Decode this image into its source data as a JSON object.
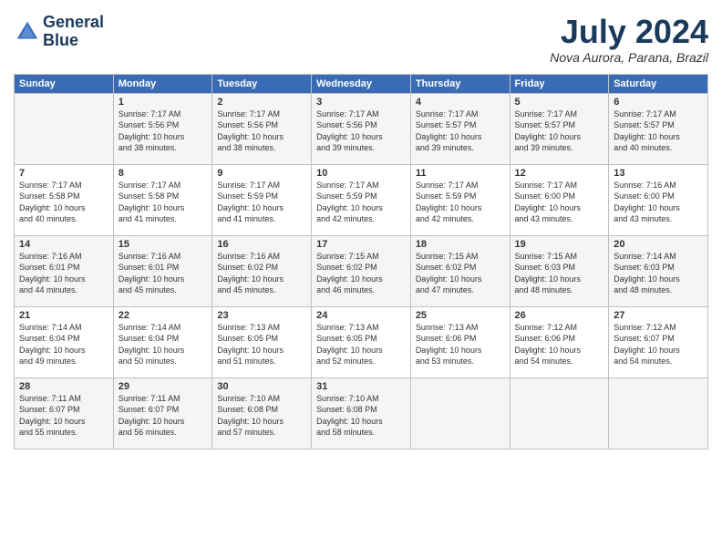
{
  "header": {
    "logo_line1": "General",
    "logo_line2": "Blue",
    "title": "July 2024",
    "location": "Nova Aurora, Parana, Brazil"
  },
  "days_of_week": [
    "Sunday",
    "Monday",
    "Tuesday",
    "Wednesday",
    "Thursday",
    "Friday",
    "Saturday"
  ],
  "weeks": [
    [
      {
        "day": "",
        "content": ""
      },
      {
        "day": "1",
        "content": "Sunrise: 7:17 AM\nSunset: 5:56 PM\nDaylight: 10 hours\nand 38 minutes."
      },
      {
        "day": "2",
        "content": "Sunrise: 7:17 AM\nSunset: 5:56 PM\nDaylight: 10 hours\nand 38 minutes."
      },
      {
        "day": "3",
        "content": "Sunrise: 7:17 AM\nSunset: 5:56 PM\nDaylight: 10 hours\nand 39 minutes."
      },
      {
        "day": "4",
        "content": "Sunrise: 7:17 AM\nSunset: 5:57 PM\nDaylight: 10 hours\nand 39 minutes."
      },
      {
        "day": "5",
        "content": "Sunrise: 7:17 AM\nSunset: 5:57 PM\nDaylight: 10 hours\nand 39 minutes."
      },
      {
        "day": "6",
        "content": "Sunrise: 7:17 AM\nSunset: 5:57 PM\nDaylight: 10 hours\nand 40 minutes."
      }
    ],
    [
      {
        "day": "7",
        "content": "Sunrise: 7:17 AM\nSunset: 5:58 PM\nDaylight: 10 hours\nand 40 minutes."
      },
      {
        "day": "8",
        "content": "Sunrise: 7:17 AM\nSunset: 5:58 PM\nDaylight: 10 hours\nand 41 minutes."
      },
      {
        "day": "9",
        "content": "Sunrise: 7:17 AM\nSunset: 5:59 PM\nDaylight: 10 hours\nand 41 minutes."
      },
      {
        "day": "10",
        "content": "Sunrise: 7:17 AM\nSunset: 5:59 PM\nDaylight: 10 hours\nand 42 minutes."
      },
      {
        "day": "11",
        "content": "Sunrise: 7:17 AM\nSunset: 5:59 PM\nDaylight: 10 hours\nand 42 minutes."
      },
      {
        "day": "12",
        "content": "Sunrise: 7:17 AM\nSunset: 6:00 PM\nDaylight: 10 hours\nand 43 minutes."
      },
      {
        "day": "13",
        "content": "Sunrise: 7:16 AM\nSunset: 6:00 PM\nDaylight: 10 hours\nand 43 minutes."
      }
    ],
    [
      {
        "day": "14",
        "content": "Sunrise: 7:16 AM\nSunset: 6:01 PM\nDaylight: 10 hours\nand 44 minutes."
      },
      {
        "day": "15",
        "content": "Sunrise: 7:16 AM\nSunset: 6:01 PM\nDaylight: 10 hours\nand 45 minutes."
      },
      {
        "day": "16",
        "content": "Sunrise: 7:16 AM\nSunset: 6:02 PM\nDaylight: 10 hours\nand 45 minutes."
      },
      {
        "day": "17",
        "content": "Sunrise: 7:15 AM\nSunset: 6:02 PM\nDaylight: 10 hours\nand 46 minutes."
      },
      {
        "day": "18",
        "content": "Sunrise: 7:15 AM\nSunset: 6:02 PM\nDaylight: 10 hours\nand 47 minutes."
      },
      {
        "day": "19",
        "content": "Sunrise: 7:15 AM\nSunset: 6:03 PM\nDaylight: 10 hours\nand 48 minutes."
      },
      {
        "day": "20",
        "content": "Sunrise: 7:14 AM\nSunset: 6:03 PM\nDaylight: 10 hours\nand 48 minutes."
      }
    ],
    [
      {
        "day": "21",
        "content": "Sunrise: 7:14 AM\nSunset: 6:04 PM\nDaylight: 10 hours\nand 49 minutes."
      },
      {
        "day": "22",
        "content": "Sunrise: 7:14 AM\nSunset: 6:04 PM\nDaylight: 10 hours\nand 50 minutes."
      },
      {
        "day": "23",
        "content": "Sunrise: 7:13 AM\nSunset: 6:05 PM\nDaylight: 10 hours\nand 51 minutes."
      },
      {
        "day": "24",
        "content": "Sunrise: 7:13 AM\nSunset: 6:05 PM\nDaylight: 10 hours\nand 52 minutes."
      },
      {
        "day": "25",
        "content": "Sunrise: 7:13 AM\nSunset: 6:06 PM\nDaylight: 10 hours\nand 53 minutes."
      },
      {
        "day": "26",
        "content": "Sunrise: 7:12 AM\nSunset: 6:06 PM\nDaylight: 10 hours\nand 54 minutes."
      },
      {
        "day": "27",
        "content": "Sunrise: 7:12 AM\nSunset: 6:07 PM\nDaylight: 10 hours\nand 54 minutes."
      }
    ],
    [
      {
        "day": "28",
        "content": "Sunrise: 7:11 AM\nSunset: 6:07 PM\nDaylight: 10 hours\nand 55 minutes."
      },
      {
        "day": "29",
        "content": "Sunrise: 7:11 AM\nSunset: 6:07 PM\nDaylight: 10 hours\nand 56 minutes."
      },
      {
        "day": "30",
        "content": "Sunrise: 7:10 AM\nSunset: 6:08 PM\nDaylight: 10 hours\nand 57 minutes."
      },
      {
        "day": "31",
        "content": "Sunrise: 7:10 AM\nSunset: 6:08 PM\nDaylight: 10 hours\nand 58 minutes."
      },
      {
        "day": "",
        "content": ""
      },
      {
        "day": "",
        "content": ""
      },
      {
        "day": "",
        "content": ""
      }
    ]
  ]
}
